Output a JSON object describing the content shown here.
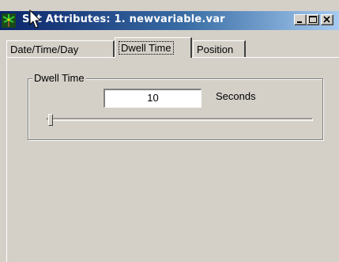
{
  "window": {
    "title": "Set Attributes: 1. newvariable.var",
    "title_visible_prefix": "S",
    "title_rest": "t Attributes: 1. newvariable.var"
  },
  "title_buttons": {
    "minimize": "minimize",
    "maximize": "maximize",
    "close": "close"
  },
  "tabs": [
    {
      "label": "Date/Time/Day",
      "active": false
    },
    {
      "label": "Dwell Time",
      "active": true
    },
    {
      "label": "Position",
      "active": false
    }
  ],
  "dwell_group": {
    "label": "Dwell Time",
    "value": "10",
    "units": "Seconds"
  },
  "slider": {
    "value_fraction": 0.0
  },
  "colors": {
    "titlebar_start": "#0a246a",
    "titlebar_end": "#a6caf0",
    "face": "#d4d0c8"
  }
}
